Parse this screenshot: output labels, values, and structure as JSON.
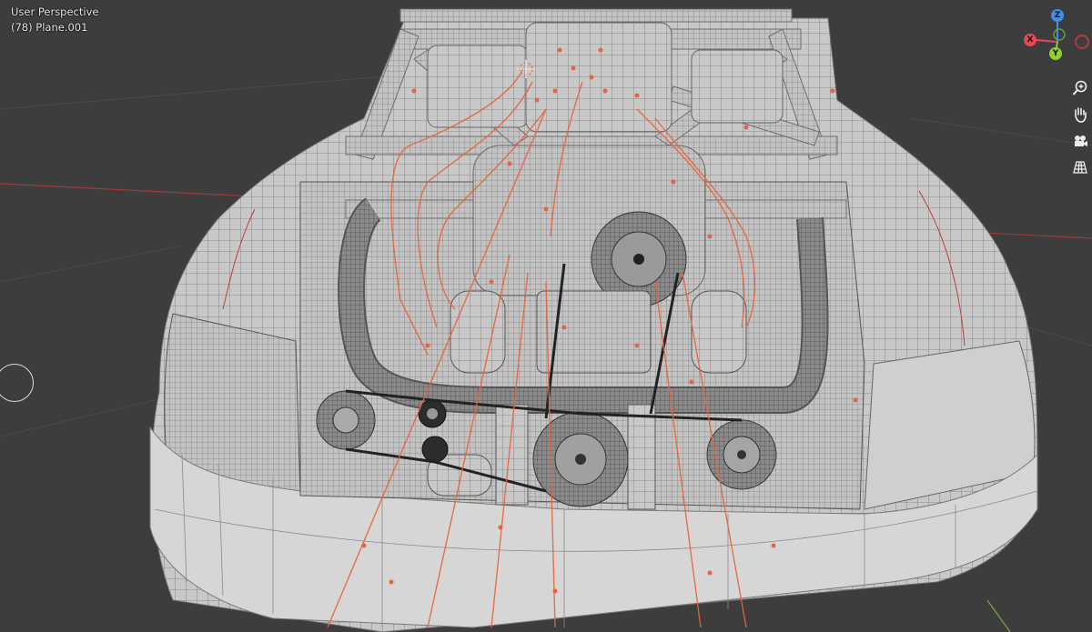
{
  "viewport": {
    "view_name": "User Perspective",
    "object_info": "(78) Plane.001"
  },
  "gizmo": {
    "axes": [
      {
        "id": "z",
        "label": "Z",
        "color": "#3d8ff0"
      },
      {
        "id": "x",
        "label": "X",
        "color": "#e8475a"
      },
      {
        "id": "y",
        "label": "Y",
        "color": "#8bd12f"
      },
      {
        "id": "neg-x",
        "label": "",
        "color": "#b33a46"
      }
    ]
  },
  "nav_buttons": [
    {
      "name": "zoom",
      "icon": "magnifier-plus-icon"
    },
    {
      "name": "pan",
      "icon": "hand-icon"
    },
    {
      "name": "camera",
      "icon": "camera-icon"
    },
    {
      "name": "perspective",
      "icon": "grid-perspective-icon"
    }
  ],
  "colors": {
    "background": "#3d3d3d",
    "mesh": "#c9c9c9",
    "wire": "#4a4a4a",
    "selection": "#e8643c",
    "x_axis_line": "#9e3a3a"
  }
}
